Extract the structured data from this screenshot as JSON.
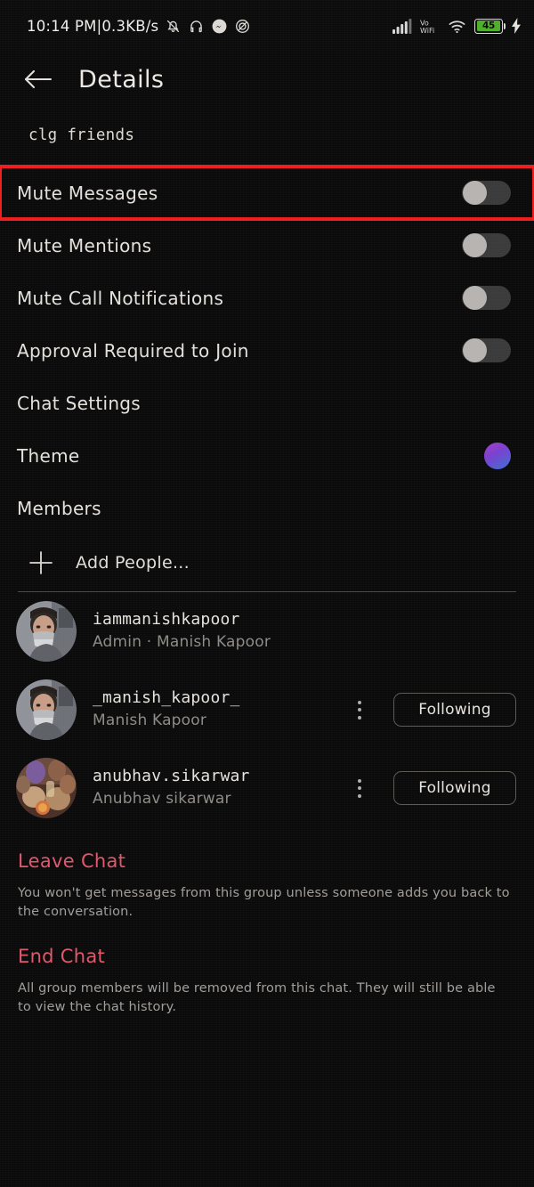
{
  "statusbar": {
    "time": "10:14 PM",
    "separator": "|",
    "network_speed": "0.3KB/s",
    "left_icons": [
      "bell-muted-icon",
      "headphones-icon",
      "messenger-icon",
      "dnd-icon"
    ],
    "signal": "signal-bars-icon",
    "volte": "Vo WiFi",
    "volte_line1": "Vo",
    "volte_line2": "WiFi",
    "wifi": "wifi-icon",
    "battery_percent": "45",
    "charging": "charging-bolt-icon"
  },
  "header": {
    "back": "back-arrow-icon",
    "title": "Details"
  },
  "group": {
    "name": "clg friends"
  },
  "settings_rows": [
    {
      "label": "Mute Messages",
      "control": "toggle",
      "on": false,
      "highlighted": true
    },
    {
      "label": "Mute Mentions",
      "control": "toggle",
      "on": false,
      "highlighted": false
    },
    {
      "label": "Mute Call Notifications",
      "control": "toggle",
      "on": false,
      "highlighted": false
    },
    {
      "label": "Approval Required to Join",
      "control": "toggle",
      "on": false,
      "highlighted": false
    },
    {
      "label": "Chat Settings",
      "control": "none",
      "on": false,
      "highlighted": false
    },
    {
      "label": "Theme",
      "control": "theme-dot",
      "on": false,
      "highlighted": false
    },
    {
      "label": "Members",
      "control": "none",
      "on": false,
      "highlighted": false
    }
  ],
  "add_people": {
    "icon": "plus-icon",
    "label": "Add People..."
  },
  "members": [
    {
      "username": "iammanishkapoor",
      "subtitle": "Admin · Manish Kapoor",
      "avatar": "person-masked-photo",
      "has_menu": false,
      "action_label": ""
    },
    {
      "username": "_manish_kapoor_",
      "subtitle": "Manish Kapoor",
      "avatar": "person-masked-photo",
      "has_menu": true,
      "action_label": "Following"
    },
    {
      "username": "anubhav.sikarwar",
      "subtitle": "Anubhav sikarwar",
      "avatar": "group-photo",
      "has_menu": true,
      "action_label": "Following"
    }
  ],
  "leave_chat": {
    "title": "Leave Chat",
    "description": "You won't get messages from this group unless someone adds you back to the conversation."
  },
  "end_chat": {
    "title": "End Chat",
    "description": "All group members will be removed from this chat. They will still be able to view the chat history."
  },
  "colors": {
    "background": "#0a0a0a",
    "text_primary": "#e6e2de",
    "text_secondary": "#8e8a86",
    "danger": "#e0566b",
    "highlight_border": "#f01b1b",
    "battery_green": "#4caf28",
    "theme_gradient_start": "#a53ec4",
    "theme_gradient_end": "#3b6fd4"
  }
}
